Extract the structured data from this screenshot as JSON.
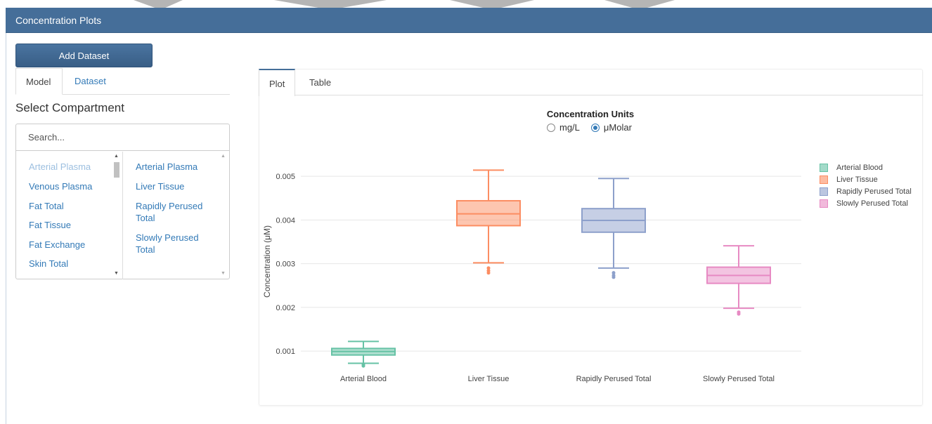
{
  "window": {
    "title": "Concentration Plots"
  },
  "toolbar": {
    "add_dataset_label": "Add Dataset"
  },
  "left_tabs": [
    {
      "label": "Model",
      "active": true
    },
    {
      "label": "Dataset",
      "active": false
    }
  ],
  "compartment": {
    "heading": "Select Compartment",
    "search_placeholder": "Search...",
    "available": [
      "Arterial Plasma",
      "Venous Plasma",
      "Fat Total",
      "Fat Tissue",
      "Fat Exchange",
      "Skin Total"
    ],
    "selected": [
      "Arterial Plasma",
      "Liver Tissue",
      "Rapidly Perused Total",
      "Slowly Perused Total"
    ]
  },
  "plot_tabs": [
    {
      "label": "Plot",
      "active": true
    },
    {
      "label": "Table",
      "active": false
    }
  ],
  "units": {
    "title": "Concentration Units",
    "options": [
      "mg/L",
      "μMolar"
    ],
    "selected": "μMolar"
  },
  "colors": {
    "header": "#456e99",
    "link": "#337ab7"
  },
  "chart_data": {
    "type": "box",
    "ylabel": "Concentration (μM)",
    "xlabel": "",
    "ylim": [
      0.0006,
      0.0055
    ],
    "yticks": [
      0.001,
      0.002,
      0.003,
      0.004,
      0.005
    ],
    "ytick_labels": [
      "0.001",
      "0.002",
      "0.003",
      "0.004",
      "0.005"
    ],
    "grid": true,
    "legend_position": "right",
    "series": [
      {
        "name": "Arterial Blood",
        "color": "#66c2a5",
        "min": 0.00072,
        "q1": 0.00091,
        "median": 0.00099,
        "q3": 0.00106,
        "max": 0.00122,
        "outliers": [
          0.00066,
          0.00069
        ]
      },
      {
        "name": "Liver Tissue",
        "color": "#fc8d62",
        "min": 0.00302,
        "q1": 0.00387,
        "median": 0.00414,
        "q3": 0.00444,
        "max": 0.00514,
        "outliers": [
          0.00279,
          0.00284,
          0.0029
        ]
      },
      {
        "name": "Rapidly Perused Total",
        "color": "#8da0cb",
        "min": 0.0029,
        "q1": 0.00372,
        "median": 0.00399,
        "q3": 0.00426,
        "max": 0.00495,
        "outliers": [
          0.00269,
          0.00273,
          0.00279
        ]
      },
      {
        "name": "Slowly Perused Total",
        "color": "#e78ac3",
        "min": 0.00198,
        "q1": 0.00255,
        "median": 0.00273,
        "q3": 0.00292,
        "max": 0.00341,
        "outliers": [
          0.00185,
          0.00189
        ]
      }
    ]
  }
}
